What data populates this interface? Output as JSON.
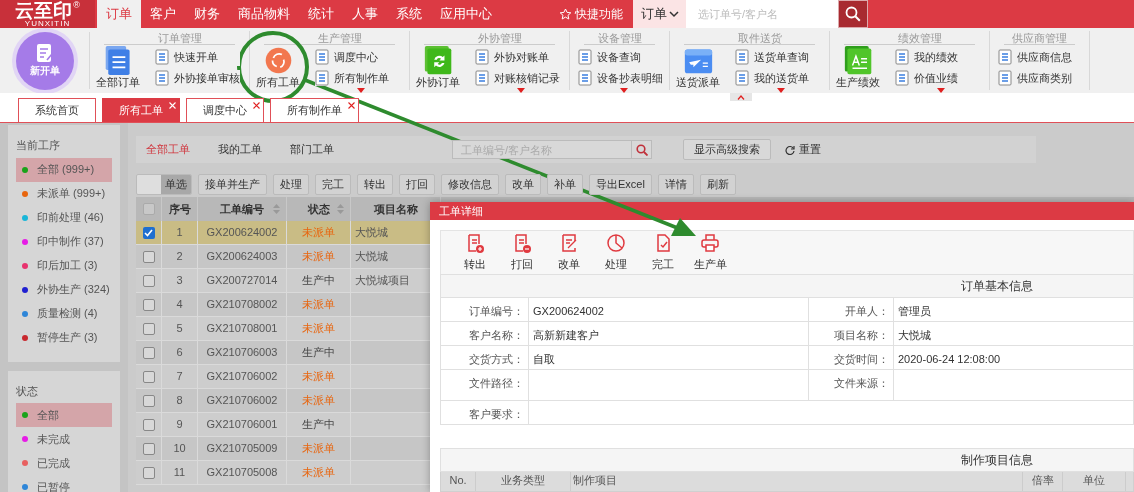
{
  "logo": {
    "text": "云至印",
    "registered": "®",
    "subtitle": "YUNXITIN"
  },
  "nav": [
    {
      "label": "订单",
      "selected": true
    },
    {
      "label": "客户",
      "selected": false
    },
    {
      "label": "财务",
      "selected": false
    },
    {
      "label": "商品物料",
      "selected": false
    },
    {
      "label": "统计",
      "selected": false
    },
    {
      "label": "人事",
      "selected": false
    },
    {
      "label": "系统",
      "selected": false
    },
    {
      "label": "应用中心",
      "selected": false
    }
  ],
  "quick_functions": "快捷功能",
  "search": {
    "scope": "订单",
    "placeholder": "选订单号/客户名"
  },
  "new_order": "新开单",
  "ribbon": [
    {
      "title": "订单管理",
      "big": {
        "label": "全部订单",
        "kind": "docs"
      },
      "items": [
        "快速开单",
        "外协接单审核"
      ],
      "more": false
    },
    {
      "title": "生产管理",
      "big": {
        "label": "所有工单",
        "kind": "cycle"
      },
      "items": [
        "调度中心",
        "所有制作单"
      ],
      "more": true
    },
    {
      "title": "外协管理",
      "big": {
        "label": "外协订单",
        "kind": "sync"
      },
      "items": [
        "外协对账单",
        "对账核销记录"
      ],
      "more": true
    },
    {
      "title": "设备管理",
      "items": [
        "设备查询",
        "设备抄表明细"
      ],
      "more": true
    },
    {
      "title": "取件送货",
      "big": {
        "label": "送货派单",
        "kind": "plane"
      },
      "items": [
        "送货单查询",
        "我的送货单"
      ],
      "more": true
    },
    {
      "title": "绩效管理",
      "big": {
        "label": "生产绩效",
        "kind": "sheet"
      },
      "items": [
        "我的绩效",
        "价值业绩"
      ],
      "more": true
    },
    {
      "title": "供应商管理",
      "items": [
        "供应商信息",
        "供应商类别"
      ],
      "more": false
    }
  ],
  "tabs": [
    {
      "label": "系统首页",
      "selected": false,
      "closable": false
    },
    {
      "label": "所有工单",
      "selected": true,
      "closable": true
    },
    {
      "label": "调度中心",
      "selected": false,
      "closable": true
    },
    {
      "label": "所有制作单",
      "selected": false,
      "closable": true
    }
  ],
  "sidebar": [
    {
      "title": "当前工序",
      "items": [
        {
          "label": "全部 (999+)",
          "color": "#1aa31a",
          "selected": true
        },
        {
          "label": "未派单 (999+)",
          "color": "#e8650e",
          "selected": false
        },
        {
          "label": "印前处理 (46)",
          "color": "#1ab6d8",
          "selected": false
        },
        {
          "label": "印中制作 (37)",
          "color": "#e61ce6",
          "selected": false
        },
        {
          "label": "印后加工 (3)",
          "color": "#e8336e",
          "selected": false
        },
        {
          "label": "外协生产 (324)",
          "color": "#2020d0",
          "selected": false
        },
        {
          "label": "质量检测 (4)",
          "color": "#2e86d8",
          "selected": false
        },
        {
          "label": "暂停生产 (3)",
          "color": "#c8282e",
          "selected": false
        }
      ]
    },
    {
      "title": "状态",
      "items": [
        {
          "label": "全部",
          "color": "#1aa31a",
          "selected": true
        },
        {
          "label": "未完成",
          "color": "#e61ce6",
          "selected": false
        },
        {
          "label": "已完成",
          "color": "#e86060",
          "selected": false
        },
        {
          "label": "已暂停",
          "color": "#2e86d8",
          "selected": false
        }
      ]
    }
  ],
  "filter_tabs": [
    {
      "label": "全部工单",
      "selected": true
    },
    {
      "label": "我的工单",
      "selected": false
    },
    {
      "label": "部门工单",
      "selected": false
    }
  ],
  "order_search": {
    "placeholder": "工单编号/客户名称"
  },
  "advanced_search": "显示高级搜索",
  "reset": "重置",
  "select_mode": {
    "label": "单选",
    "on": true
  },
  "toolbar": [
    "接单并生产",
    "处理",
    "完工",
    "转出",
    "打回",
    "修改信息",
    "改单",
    "补单",
    "导出Excel",
    "详情",
    "刷新"
  ],
  "table": {
    "all_checked": false,
    "columns": [
      "序号",
      "工单编号",
      "状态",
      "项目名称"
    ],
    "rows": [
      {
        "no": "1",
        "code": "GX200624002",
        "status": "未派单",
        "kind": "pending",
        "project": "大悦城",
        "checked": true,
        "selected": true
      },
      {
        "no": "2",
        "code": "GX200624003",
        "status": "未派单",
        "kind": "pending",
        "project": "大悦城",
        "checked": false,
        "selected": false
      },
      {
        "no": "3",
        "code": "GX200727014",
        "status": "生产中",
        "kind": "in_production",
        "project": "大悦城项目",
        "checked": false,
        "selected": false
      },
      {
        "no": "4",
        "code": "GX210708002",
        "status": "未派单",
        "kind": "pending",
        "checked": false,
        "selected": false
      },
      {
        "no": "5",
        "code": "GX210708001",
        "status": "未派单",
        "kind": "pending",
        "checked": false,
        "selected": false
      },
      {
        "no": "6",
        "code": "GX210706003",
        "status": "生产中",
        "kind": "in_production",
        "checked": false,
        "selected": false
      },
      {
        "no": "7",
        "code": "GX210706002",
        "status": "未派单",
        "kind": "pending",
        "checked": false,
        "selected": false
      },
      {
        "no": "8",
        "code": "GX210706002",
        "status": "未派单",
        "kind": "pending",
        "checked": false,
        "selected": false
      },
      {
        "no": "9",
        "code": "GX210706001",
        "status": "生产中",
        "kind": "in_production",
        "checked": false,
        "selected": false
      },
      {
        "no": "10",
        "code": "GX210705009",
        "status": "未派单",
        "kind": "pending",
        "checked": false,
        "selected": false
      },
      {
        "no": "11",
        "code": "GX210705008",
        "status": "未派单",
        "kind": "pending",
        "checked": false,
        "selected": false
      }
    ]
  },
  "dialog": {
    "title": "工单详细",
    "actions": [
      {
        "label": "转出",
        "kind": "out"
      },
      {
        "label": "打回",
        "kind": "back"
      },
      {
        "label": "改单",
        "kind": "edit"
      },
      {
        "label": "处理",
        "kind": "pie"
      },
      {
        "label": "完工",
        "kind": "done"
      },
      {
        "label": "生产单",
        "kind": "print"
      }
    ],
    "basic_info": {
      "title": "订单基本信息",
      "rows": [
        {
          "label": "订单编号：",
          "value": "GX200624002",
          "label2": "开单人：",
          "value2": "管理员"
        },
        {
          "label": "客户名称：",
          "value": "高新新建客户",
          "label2": "项目名称：",
          "value2": "大悦城"
        },
        {
          "label": "交货方式：",
          "value": "自取",
          "label2": "交货时间：",
          "value2": "2020-06-24 12:08:00"
        },
        {
          "label": "文件路径：",
          "label2": "文件来源："
        },
        {
          "label": "客户要求："
        }
      ]
    },
    "items_info": {
      "title": "制作项目信息",
      "columns": [
        "No.",
        "业务类型",
        "制作项目",
        "倍率",
        "单位"
      ]
    }
  },
  "annotation": {
    "kind": "circle-arrow"
  }
}
